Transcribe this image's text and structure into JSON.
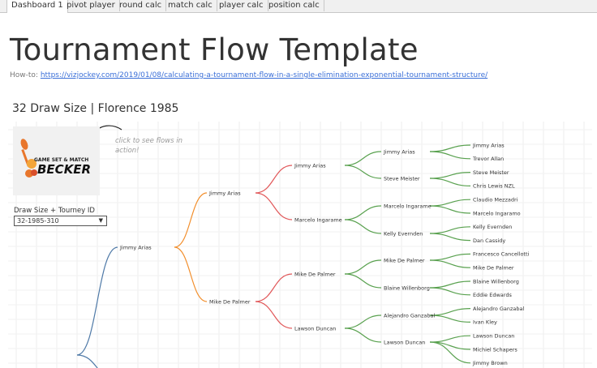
{
  "tabs": [
    {
      "label": "Dashboard 1"
    },
    {
      "label": "pivot player"
    },
    {
      "label": "round calc"
    },
    {
      "label": "match calc"
    },
    {
      "label": "player calc"
    },
    {
      "label": "position calc"
    }
  ],
  "header": {
    "title": "Tournament Flow Template",
    "howto_prefix": "How-to: ",
    "howto_link": "https://vizjockey.com/2019/01/08/calculating-a-tournament-flow-in-a-single-elimination-exponential-tournament-structure/"
  },
  "subtitle": "32 Draw Size | Florence 1985",
  "logo": {
    "text_top": "GAME SET & MATCH",
    "text_main": "BECKER"
  },
  "hint": "click to see flows in action!",
  "filter": {
    "label": "Draw Size + Tourney ID",
    "value": "32-1985-310"
  },
  "colors": {
    "r2": "#4e79a7",
    "r3": "#f28e2b",
    "r4": "#e15759",
    "r5": "#59a14f",
    "r6": "#59a14f"
  },
  "rounds": {
    "r2": [
      "Jimmy Arias"
    ],
    "r3": [
      "Jimmy Arias",
      "Mike De Palmer"
    ],
    "r4": [
      "Jimmy Arias",
      "Marcelo Ingarame",
      "Mike De Palmer",
      "Lawson Duncan"
    ],
    "r5": [
      "Jimmy Arias",
      "Steve Meister",
      "Marcelo Ingarame",
      "Kelly Evernden",
      "Mike De Palmer",
      "Blaine Willenborg",
      "Alejandro Ganzabal",
      "Lawson Duncan"
    ],
    "r6": [
      "Jimmy Arias",
      "Trevor Allan",
      "Steve Meister",
      "Chris Lewis NZL",
      "Claudio Mezzadri",
      "Marcelo Ingaramo",
      "Kelly Evernden",
      "Dan Cassidy",
      "Francesco Cancellotti",
      "Mike De Palmer",
      "Blaine Willenborg",
      "Eddie Edwards",
      "Alejandro Ganzabal",
      "Ivan Kley",
      "Lawson Duncan",
      "Michiel Schapers",
      "Jimmy Brown"
    ]
  }
}
